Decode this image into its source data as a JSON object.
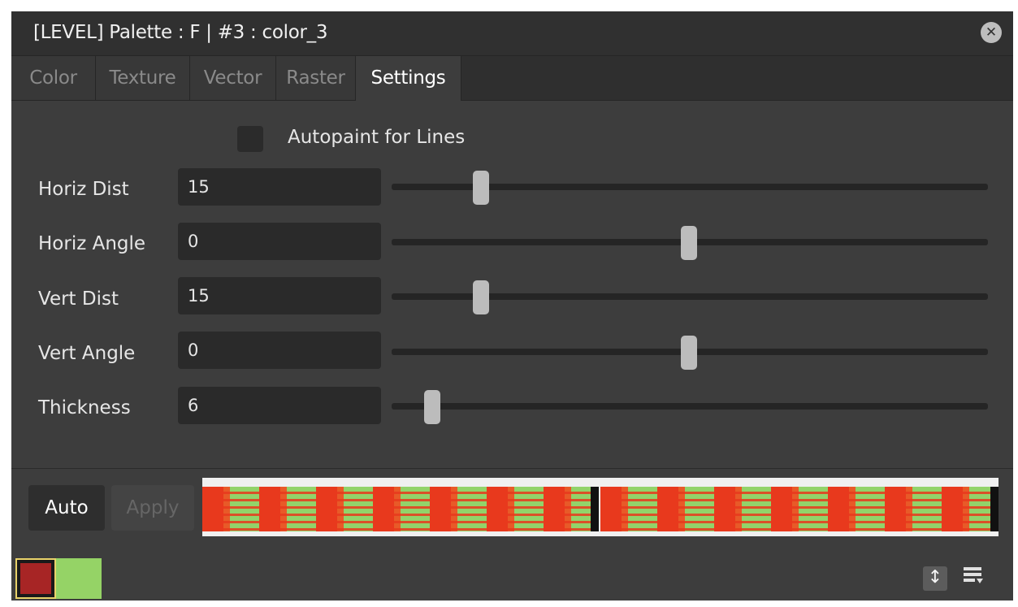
{
  "window": {
    "title": "[LEVEL]  Palette : F | #3 : color_3"
  },
  "tabs": [
    {
      "label": "Color",
      "active": false
    },
    {
      "label": "Texture",
      "active": false
    },
    {
      "label": "Vector",
      "active": false
    },
    {
      "label": "Raster",
      "active": false
    },
    {
      "label": "Settings",
      "active": true
    }
  ],
  "settings": {
    "autopaint": {
      "label": "Autopaint for Lines",
      "checked": false
    },
    "rows": [
      {
        "label": "Horiz Dist",
        "value": "15",
        "slider_fraction": 0.15
      },
      {
        "label": "Horiz Angle",
        "value": "0",
        "slider_fraction": 0.5
      },
      {
        "label": "Vert Dist",
        "value": "15",
        "slider_fraction": 0.15
      },
      {
        "label": "Vert Angle",
        "value": "0",
        "slider_fraction": 0.5
      },
      {
        "label": "Thickness",
        "value": "6",
        "slider_fraction": 0.07
      }
    ]
  },
  "footer": {
    "auto_label": "Auto",
    "apply_label": "Apply",
    "apply_enabled": false
  },
  "colors": {
    "current_style": "#a72525",
    "previous_style": "#95d366",
    "preview_red": "#e8391d",
    "preview_green": "#92d36a"
  },
  "icons": {
    "close": "close-icon",
    "orientation": "vertical-arrows-icon",
    "menu": "list-menu-icon"
  }
}
